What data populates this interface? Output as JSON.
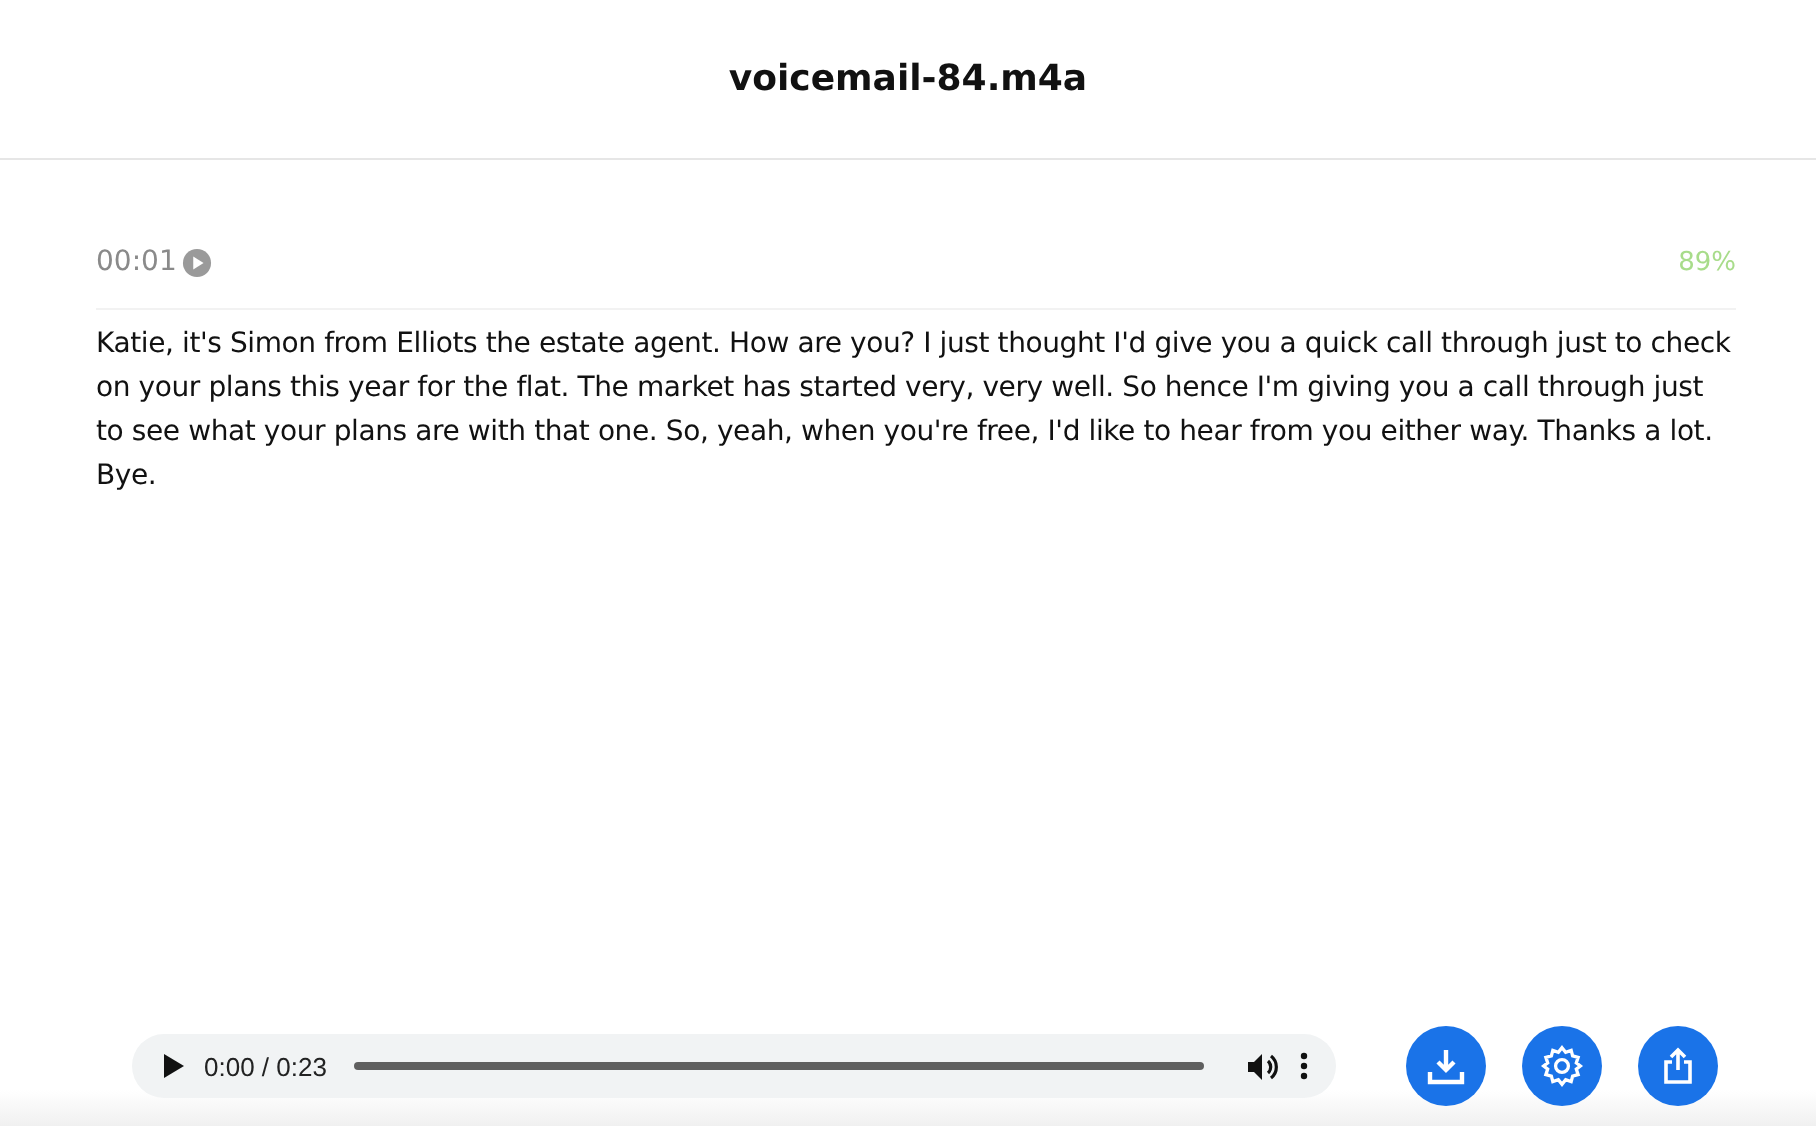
{
  "header": {
    "title": "voicemail-84.m4a"
  },
  "meta": {
    "timestamp": "00:01",
    "confidence": "89%"
  },
  "transcript": "Katie, it's Simon from Elliots the estate agent. How are you? I just thought I'd give you a quick call through just to check on your plans this year for the flat. The market has started very, very well. So hence I'm giving you a call through just to see what your plans are with that one. So, yeah, when you're free, I'd like to hear from you either way. Thanks a lot. Bye.",
  "player": {
    "time": "0:00 / 0:23"
  },
  "actions": [
    {
      "kind": "download"
    },
    {
      "kind": "settings"
    },
    {
      "kind": "share"
    }
  ]
}
